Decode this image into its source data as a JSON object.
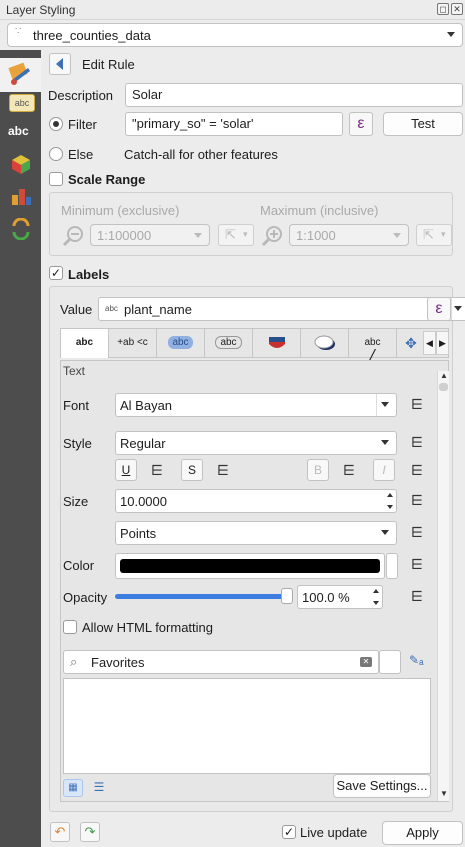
{
  "window": {
    "title": "Layer Styling"
  },
  "layer": {
    "name": "three_counties_data"
  },
  "sidebar": {
    "icons": [
      "symbology-icon",
      "labels-icon",
      "masks-icon",
      "3d-view-icon",
      "diagrams-icon",
      "history-icon"
    ]
  },
  "rule": {
    "heading": "Edit Rule",
    "description_label": "Description",
    "description_value": "Solar",
    "filter_label": "Filter",
    "filter_value": "\"primary_so\"  =  'solar'",
    "test_button": "Test",
    "else_label": "Else",
    "else_text": "Catch-all for other features",
    "expression_glyph": "ε"
  },
  "scale_range": {
    "label": "Scale Range",
    "min_label": "Minimum (exclusive)",
    "min_value": "1:100000",
    "max_label": "Maximum (inclusive)",
    "max_value": "1:1000"
  },
  "labels": {
    "label": "Labels",
    "checked": true,
    "value_label": "Value",
    "value_field": "plant_name",
    "value_prefix": "abc",
    "tabs": [
      "abc",
      "+ab <c",
      "abc",
      "abc",
      "",
      "",
      "abc",
      ""
    ],
    "text_section": "Text",
    "font_label": "Font",
    "font_value": "Al Bayan",
    "style_label": "Style",
    "style_value": "Regular",
    "underline": "U",
    "strike": "S",
    "bold": "B",
    "italic": "I",
    "size_label": "Size",
    "size_value": "10.0000",
    "unit_value": "Points",
    "color_label": "Color",
    "color_value": "#000000",
    "opacity_label": "Opacity",
    "opacity_value": "100.0 %",
    "opacity_level": 1.0,
    "allow_html_label": "Allow HTML formatting",
    "favorites_value": "Favorites",
    "save_settings": "Save Settings..."
  },
  "footer": {
    "live_update_label": "Live update",
    "live_update_checked": true,
    "apply_button": "Apply"
  }
}
